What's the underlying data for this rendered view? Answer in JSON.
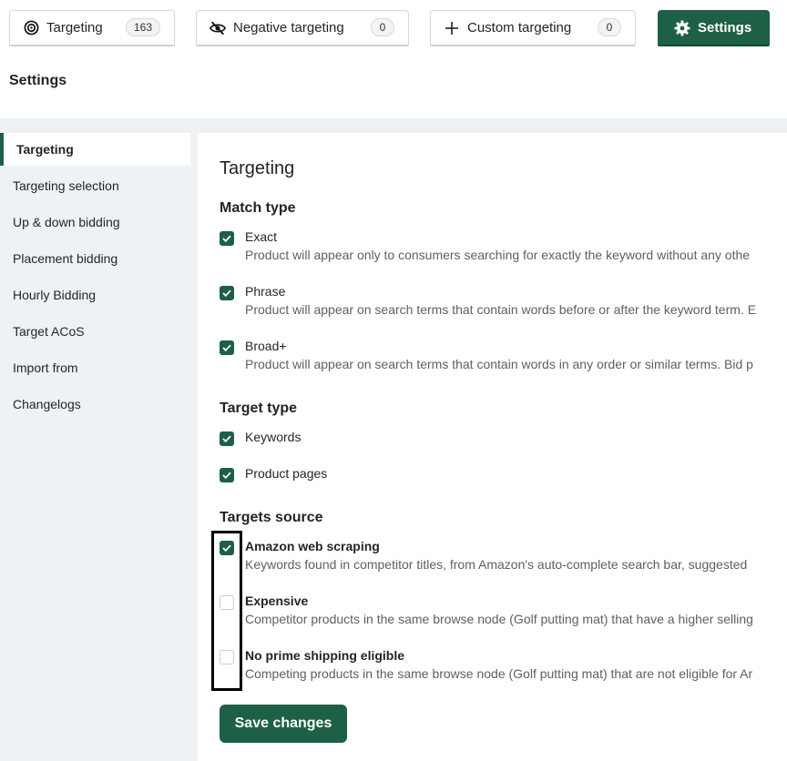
{
  "tabs": [
    {
      "label": "Targeting",
      "count": "163",
      "icon": "target-icon"
    },
    {
      "label": "Negative targeting",
      "count": "0",
      "icon": "eye-off-icon"
    },
    {
      "label": "Custom targeting",
      "count": "0",
      "icon": "plus-icon"
    },
    {
      "label": "Settings",
      "icon": "gear-icon",
      "active": true
    }
  ],
  "page_title": "Settings",
  "sidebar": {
    "items": [
      {
        "label": "Targeting",
        "active": true
      },
      {
        "label": "Targeting selection"
      },
      {
        "label": "Up & down bidding"
      },
      {
        "label": "Placement bidding"
      },
      {
        "label": "Hourly Bidding"
      },
      {
        "label": "Target ACoS"
      },
      {
        "label": "Import from"
      },
      {
        "label": "Changelogs"
      }
    ]
  },
  "panel": {
    "title": "Targeting",
    "match_type": {
      "heading": "Match type",
      "options": [
        {
          "label": "Exact",
          "checked": true,
          "desc": "Product will appear only to consumers searching for exactly the keyword without any othe"
        },
        {
          "label": "Phrase",
          "checked": true,
          "desc": "Product will appear on search terms that contain words before or after the keyword term. E"
        },
        {
          "label": "Broad+",
          "checked": true,
          "desc": "Product will appear on search terms that contain words in any order or similar terms. Bid p"
        }
      ]
    },
    "target_type": {
      "heading": "Target type",
      "options": [
        {
          "label": "Keywords",
          "checked": true
        },
        {
          "label": "Product pages",
          "checked": true
        }
      ]
    },
    "targets_source": {
      "heading": "Targets source",
      "options": [
        {
          "label": "Amazon web scraping",
          "checked": true,
          "desc": "Keywords found in competitor titles, from Amazon's auto-complete search bar, suggested"
        },
        {
          "label": "Expensive",
          "checked": false,
          "desc": "Competitor products in the same browse node (Golf putting mat) that have a higher selling"
        },
        {
          "label": "No prime shipping eligible",
          "checked": false,
          "desc": "Competing products in the same browse node (Golf putting mat) that are not eligible for Ar"
        }
      ]
    },
    "save_label": "Save changes"
  },
  "colors": {
    "accent": "#1e6045",
    "band": "#eff2f5"
  }
}
